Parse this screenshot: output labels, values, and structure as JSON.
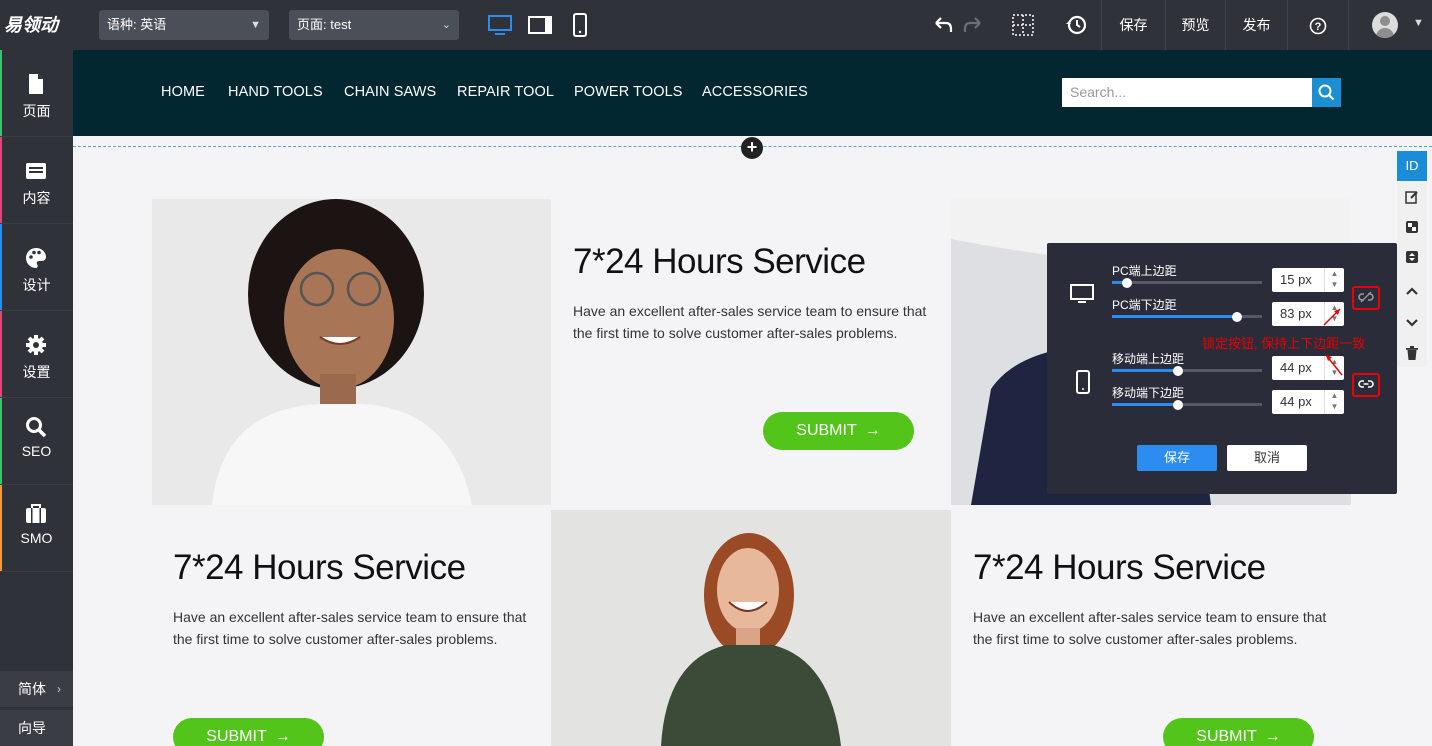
{
  "topbar": {
    "logo": "易领动",
    "language": "语种: 英语",
    "page": "页面: test",
    "save": "保存",
    "preview": "预览",
    "publish": "发布",
    "help": "?"
  },
  "sidebar": {
    "items": [
      {
        "label": "页面",
        "icon": "page-icon",
        "color": "#3cc26b"
      },
      {
        "label": "内容",
        "icon": "content-icon",
        "color": "#e0457b"
      },
      {
        "label": "设计",
        "icon": "palette-icon",
        "color": "#2d8cf0"
      },
      {
        "label": "设置",
        "icon": "gear-icon",
        "color": "#e0457b"
      },
      {
        "label": "SEO",
        "icon": "search-icon",
        "color": "#3cc26b"
      },
      {
        "label": "SMO",
        "icon": "briefcase-icon",
        "color": "#f29a38"
      }
    ],
    "language_switch": "简体",
    "guide": "向导"
  },
  "site_nav": {
    "links": [
      "HOME",
      "HAND TOOLS",
      "CHAIN SAWS",
      "REPAIR TOOL",
      "POWER TOOLS",
      "ACCESSORIES"
    ],
    "search_placeholder": "Search..."
  },
  "cards": [
    {
      "title": "7*24 Hours Service",
      "desc1": "Have an excellent after-sales service team to ensure that",
      "desc2": "the first time to solve customer after-sales problems.",
      "button": "SUBMIT"
    },
    {
      "title": "7*24 Hours Service",
      "desc1": "Have an excellent after-sales service team to ensure that",
      "desc2": "the first time to solve customer after-sales problems.",
      "button": "SUBMIT"
    },
    {
      "title": "7*24 Hours Service",
      "desc1": "Have an excellent after-sales service team to ensure that",
      "desc2": "the first time to solve customer after-sales problems.",
      "button": "SUBMIT"
    }
  ],
  "right_tools": {
    "id_label": "ID"
  },
  "spacing_panel": {
    "pc_top_label": "PC端上边距",
    "pc_top_value": "15 px",
    "pc_top_level": 0.1,
    "pc_bottom_label": "PC端下边距",
    "pc_bottom_value": "83 px",
    "pc_bottom_level": 0.83,
    "mobile_top_label": "移动端上边距",
    "mobile_top_value": "44 px",
    "mobile_top_level": 0.44,
    "mobile_bottom_label": "移动端下边距",
    "mobile_bottom_value": "44 px",
    "mobile_bottom_level": 0.44,
    "annotation": "锁定按钮, 保持上下边距一致",
    "save": "保存",
    "cancel": "取消"
  },
  "colors": {
    "accent": "#2d8cf0",
    "submit_green": "#52c41a",
    "nav_bg": "#022731",
    "annotation_red": "#e60000"
  }
}
